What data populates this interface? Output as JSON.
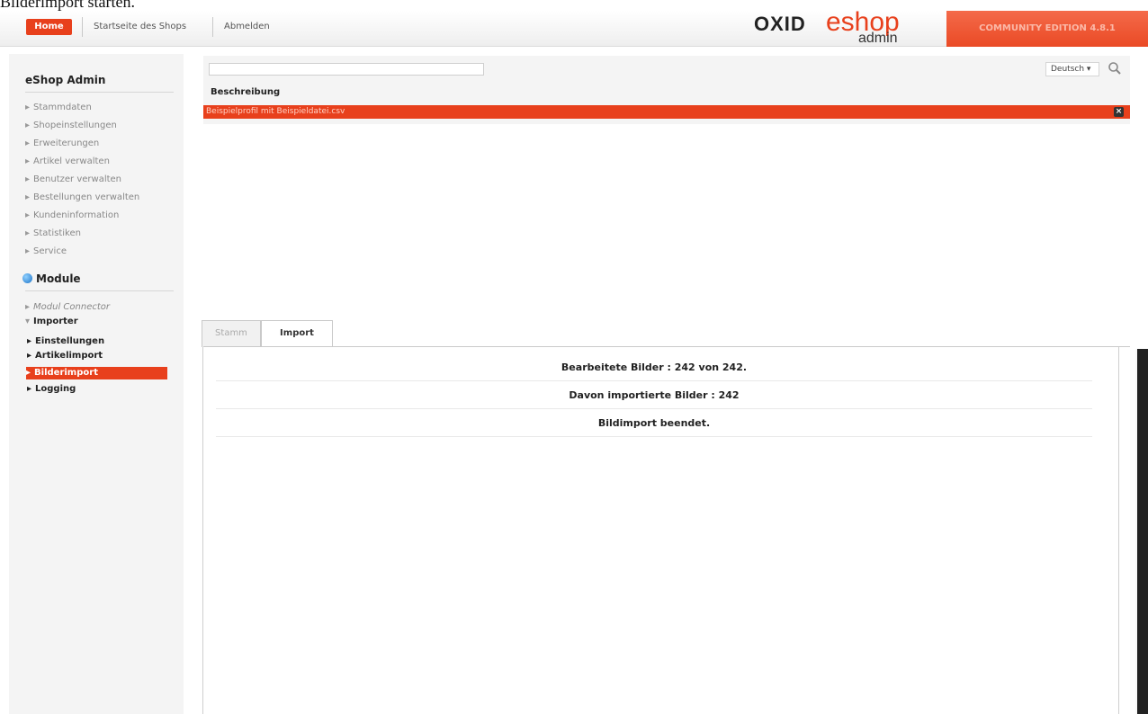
{
  "caption": "Bilderimport starten.",
  "topnav": {
    "home": "Home",
    "shop_start": "Startseite des Shops",
    "logout": "Abmelden"
  },
  "logo": {
    "oxid": "OXID",
    "eshop": "eshop",
    "admin": "admin"
  },
  "edition": "COMMUNITY EDITION 4.8.1",
  "sidebar": {
    "title": "eShop Admin",
    "items": [
      "Stammdaten",
      "Shopeinstellungen",
      "Erweiterungen",
      "Artikel verwalten",
      "Benutzer verwalten",
      "Bestellungen verwalten",
      "Kundeninformation",
      "Statistiken",
      "Service"
    ],
    "module_title": "Module",
    "module_items": [
      "Modul Connector",
      "Importer"
    ],
    "importer_sub": [
      "Einstellungen",
      "Artikelimport",
      "Bilderimport",
      "Logging"
    ]
  },
  "list": {
    "filter_value": "",
    "language": "Deutsch",
    "column_header": "Beschreibung",
    "profile": "Beispielprofil mit Beispieldatei.csv"
  },
  "tabs": {
    "stamm": "Stamm",
    "import": "Import"
  },
  "results": [
    "Bearbeitete Bilder : 242 von 242.",
    "Davon importierte Bilder : 242",
    "Bildimport beendet."
  ],
  "colors": {
    "accent": "#e8401c"
  }
}
